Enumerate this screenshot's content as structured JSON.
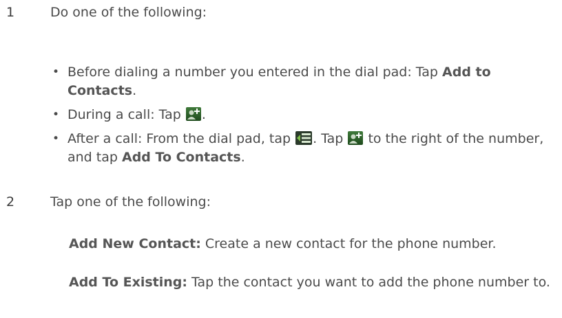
{
  "step1": {
    "number": "1",
    "intro": "Do one of the following:",
    "bullets": [
      {
        "text_before": "Before dialing a number you entered in the dial pad: Tap ",
        "bold": "Add to Contacts",
        "text_after": "."
      },
      {
        "text_before": "During a call: Tap ",
        "icon": "add-contact-icon",
        "text_after": "."
      },
      {
        "text_before": "After a call: From the dial pad, tap ",
        "icon1": "call-log-menu-icon",
        "text_mid1": ". Tap ",
        "icon2": "add-contact-icon",
        "text_mid2": " to the right of the number, and tap ",
        "bold": "Add To Contacts",
        "text_after": "."
      }
    ]
  },
  "step2": {
    "number": "2",
    "intro": "Tap one of the following:",
    "options": [
      {
        "label": "Add New Contact:",
        "description": " Create a new contact for the phone number."
      },
      {
        "label": "Add To Existing:",
        "description": " Tap the contact you want to add the phone number to."
      }
    ]
  },
  "colors": {
    "text": "#4a4a4a",
    "icon_green": "#3f7a3a"
  }
}
